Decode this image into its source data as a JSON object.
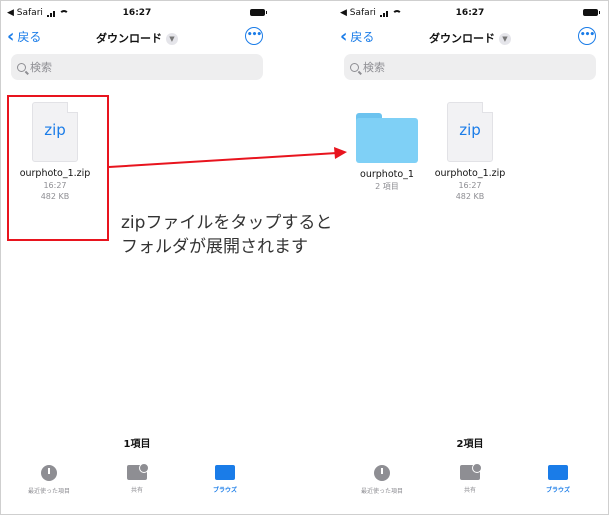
{
  "left": {
    "status": {
      "carrier": "◀ Safari",
      "time": "16:27"
    },
    "nav": {
      "back_label": "戻る",
      "title": "ダウンロード"
    },
    "search": {
      "placeholder": "検索"
    },
    "items": [
      {
        "type": "zip",
        "icon_label": "zip",
        "name": "ourphoto_1.zip",
        "time": "16:27",
        "size": "482 KB"
      }
    ],
    "count": "1項目",
    "tabs": [
      {
        "label": "最近使った項目",
        "icon": "clock-icon",
        "active": false
      },
      {
        "label": "共有",
        "icon": "shared-folder-icon",
        "active": false
      },
      {
        "label": "ブラウズ",
        "icon": "folder-icon",
        "active": true
      }
    ]
  },
  "right": {
    "status": {
      "carrier": "◀ Safari",
      "time": "16:27"
    },
    "nav": {
      "back_label": "戻る",
      "title": "ダウンロード"
    },
    "search": {
      "placeholder": "検索"
    },
    "items": [
      {
        "type": "folder",
        "name": "ourphoto_1",
        "meta": "2 項目"
      },
      {
        "type": "zip",
        "icon_label": "zip",
        "name": "ourphoto_1.zip",
        "time": "16:27",
        "size": "482 KB"
      }
    ],
    "count": "2項目",
    "tabs": [
      {
        "label": "最近使った項目",
        "icon": "clock-icon",
        "active": false
      },
      {
        "label": "共有",
        "icon": "shared-folder-icon",
        "active": false
      },
      {
        "label": "ブラウズ",
        "icon": "folder-icon",
        "active": true
      }
    ]
  },
  "annotation": {
    "line1": "zipファイルをタップすると",
    "line2": "フォルダが展開されます",
    "color": "#e8141e"
  },
  "colors": {
    "accent": "#1a7ce8",
    "folder": "#7fd0f6"
  }
}
